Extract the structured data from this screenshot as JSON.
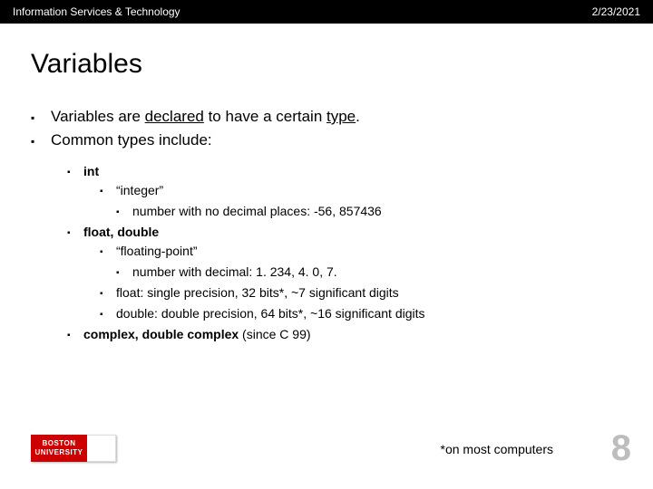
{
  "header": {
    "left": "Information Services & Technology",
    "right": "2/23/2021"
  },
  "title": "Variables",
  "bullets": {
    "b1_pre": "Variables are ",
    "b1_u1": "declared",
    "b1_mid": " to have a certain ",
    "b1_u2": "type",
    "b1_post": ".",
    "b2": "Common types include:",
    "int": "int",
    "int1": "“integer”",
    "int2": "number with no decimal places: -56,   857436",
    "float": "float, double",
    "f1": "“floating-point”",
    "f2": "number with decimal: 1. 234,  4. 0,   7.",
    "f3": "float: single precision, 32 bits*, ~7 significant digits",
    "f4": "double: double precision, 64 bits*, ~16 significant digits",
    "complex_b": "complex, double complex",
    "complex_n": " (since C 99)"
  },
  "footnote": "*on most computers",
  "page": "8",
  "logo": {
    "l1": "BOSTON",
    "l2": "UNIVERSITY"
  }
}
